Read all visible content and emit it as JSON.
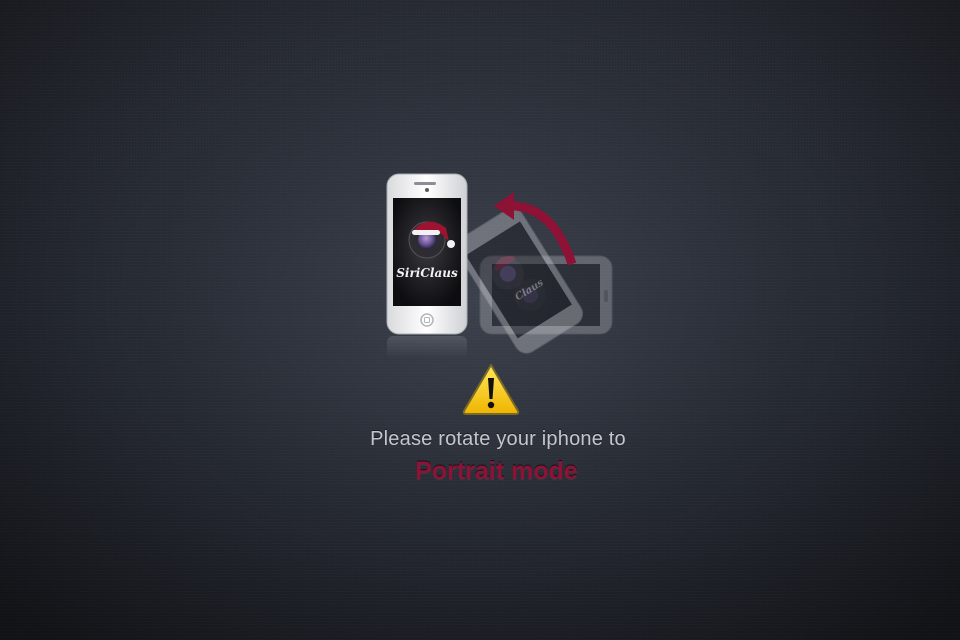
{
  "prompt": {
    "message": "Please rotate your iphone to",
    "mode": "Portrait mode"
  },
  "illustration": {
    "brand": "SiriClaus",
    "ghost_brand": "Claus",
    "rotate_arrow": "rotate-arrow-icon",
    "warning": "warning-icon"
  },
  "colors": {
    "accent": "#8e1236",
    "text": "#c4c6cb",
    "background": "#262a33",
    "warning_yellow": "#f5c400"
  }
}
